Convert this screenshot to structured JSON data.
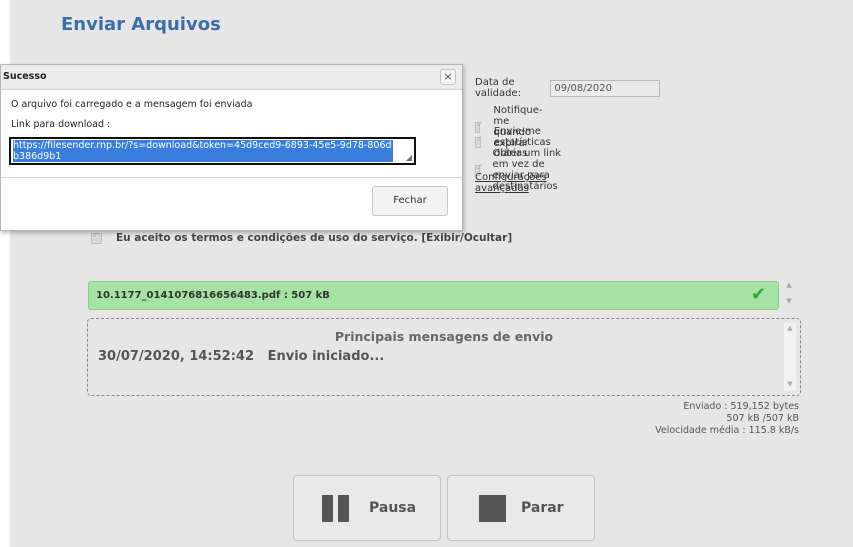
{
  "page": {
    "title": "Enviar Arquivos"
  },
  "options": {
    "validity_label": "Data de validade:",
    "validity_value": "09/08/2020",
    "notify_expire": "Notifique-me quando expirar",
    "daily_stats": "Envie-me estatísticas diárias",
    "get_link": "Obter um link em vez de enviar para destinatários",
    "advanced_link": "Configurações avançadas"
  },
  "terms": {
    "text": "Eu aceito os termos e condições de uso do serviço.",
    "toggle": "[Exibir/Ocultar]"
  },
  "file": {
    "label": "10.1177_0141076816656483.pdf : 507 kB",
    "status_icon": "check-icon",
    "status_color": "#3aa53a"
  },
  "messages": {
    "title": "Principais mensagens de envio",
    "entries": [
      {
        "time": "30/07/2020, 14:52:42",
        "text": "Envio iniciado..."
      }
    ]
  },
  "stats": {
    "sent": "Enviado : 519,152 bytes",
    "progress": "507 kB /507 kB",
    "speed": "Velocidade média : 115.8 kB/s"
  },
  "buttons": {
    "pause": "Pausa",
    "stop": "Parar"
  },
  "dialog": {
    "title": "Sucesso",
    "message": "O arquivo foi carregado e a mensagem foi enviada",
    "link_label": "Link para download :",
    "link_url": "https://filesender.rnp.br/?s=download&token=45d9ced9-6893-45e5-9d78-806db386d9b1",
    "close_label": "Fechar",
    "close_icon": "×"
  }
}
